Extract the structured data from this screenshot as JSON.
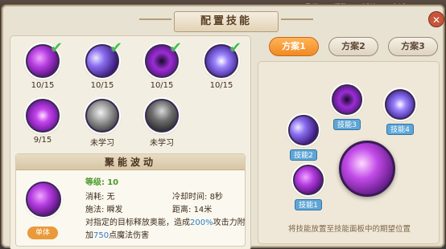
{
  "background": {
    "menu_fragments": [
      "悬赏",
      "采购",
      "活动",
      "商城"
    ]
  },
  "header": {
    "title": "配置技能",
    "close_icon": "close-icon"
  },
  "skills": [
    {
      "count": "10/15",
      "learned": true,
      "icon": "purple-vortex-orb"
    },
    {
      "count": "10/15",
      "learned": true,
      "icon": "blue-comet-orb"
    },
    {
      "count": "10/15",
      "learned": true,
      "icon": "dark-swirl-orb"
    },
    {
      "count": "10/15",
      "learned": true,
      "icon": "violet-burst-orb"
    },
    {
      "count": "9/15",
      "learned": false,
      "icon": "magenta-burst-orb"
    },
    {
      "count": "未学习",
      "learned": false,
      "icon": "gray-swirl-orb"
    },
    {
      "count": "未学习",
      "learned": false,
      "icon": "gray-figure-orb"
    }
  ],
  "selected_skill": {
    "name": "聚能波动",
    "level_label": "等级:",
    "level": "10",
    "cost_label": "消耗:",
    "cost": "无",
    "cooldown_label": "冷却时间:",
    "cooldown": "8秒",
    "cast_label": "施法:",
    "cast": "瞬发",
    "range_label": "距离:",
    "range": "14米",
    "desc_prefix": "对指定的目标释放奥能，造成",
    "desc_percent": "200%",
    "desc_mid": "攻击力附",
    "desc_line2_prefix": "加",
    "desc_flat": "750",
    "desc_suffix": "点魔法伤害",
    "type_badge": "单体"
  },
  "tabs": [
    {
      "label": "方案1",
      "active": true
    },
    {
      "label": "方案2",
      "active": false
    },
    {
      "label": "方案3",
      "active": false
    }
  ],
  "slots": [
    {
      "label": "技能1"
    },
    {
      "label": "技能2"
    },
    {
      "label": "技能3"
    },
    {
      "label": "技能4"
    }
  ],
  "hint": "将技能放置至技能面板中的期望位置",
  "colors": {
    "accent_orange": "#f08a23",
    "slot_blue": "#5fa6d6",
    "check_green": "#3fbf4a"
  }
}
